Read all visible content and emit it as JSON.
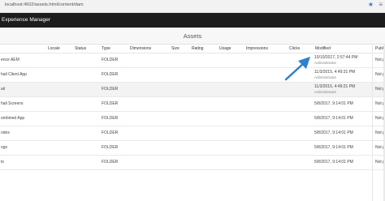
{
  "browser": {
    "url": "localhost:4502/assets.html/content/dam",
    "star_icon": "star-icon",
    "menu_icon": "menu-icon"
  },
  "app": {
    "title": "Experience Manager"
  },
  "page": {
    "title": "Assets"
  },
  "columns": {
    "locale": "Locale",
    "status": "Status",
    "type": "Type",
    "dimensions": "Dimensions",
    "size": "Size",
    "rating": "Rating",
    "usage": "Usage",
    "impressions": "Impressions",
    "clicks": "Clicks",
    "modified": "Modified",
    "published": "Publi"
  },
  "rows": [
    {
      "title": "ence AEM",
      "type": "FOLDER",
      "date": "10/10/2017, 2:57:44 PM",
      "by": "Administrator",
      "pub": "Not p"
    },
    {
      "title": "hail Client App",
      "type": "FOLDER",
      "date": "11/3/2015, 4:49:31 PM",
      "by": "Administrator",
      "pub": "Not p"
    },
    {
      "title": "ail",
      "type": "FOLDER",
      "date": "11/3/2015, 4:49:21 PM",
      "by": "Administrator",
      "pub": "Not p"
    },
    {
      "title": "hail Screens",
      "type": "FOLDER",
      "date": "5/8/2017, 9:14:01 PM",
      "by": "",
      "pub": "Not p"
    },
    {
      "title": "ombined App",
      "type": "FOLDER",
      "date": "5/8/2017, 9:14:01 PM",
      "by": "",
      "pub": "Not p"
    },
    {
      "title": "odes",
      "type": "FOLDER",
      "date": "5/8/2017, 9:14:01 PM",
      "by": "",
      "pub": "Not p"
    },
    {
      "title": "ogs",
      "type": "FOLDER",
      "date": "5/8/2017, 9:14:01 PM",
      "by": "",
      "pub": "Not p"
    },
    {
      "title": "ts",
      "type": "FOLDER",
      "date": "5/8/2017, 9:14:01 PM",
      "by": "",
      "pub": "Not p"
    }
  ],
  "colors": {
    "arrow": "#2f7fd1",
    "header_bg": "#1c1c1c"
  }
}
